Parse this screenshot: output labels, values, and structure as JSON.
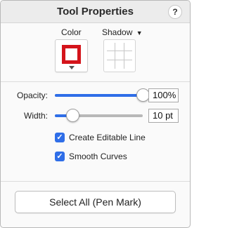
{
  "panel": {
    "title": "Tool Properties",
    "help_label": "?"
  },
  "appearance": {
    "color_label": "Color",
    "shadow_label": "Shadow",
    "shadow_caret": "▼",
    "stroke_color": "#d4141b",
    "accent_color": "#2f6ee8"
  },
  "opacity": {
    "label": "Opacity:",
    "value": "100%",
    "level": 1.0
  },
  "width": {
    "label": "Width:",
    "value": "10 pt",
    "level": 0.2
  },
  "options": {
    "create_editable_line": {
      "label": "Create Editable Line",
      "checked": true
    },
    "smooth_curves": {
      "label": "Smooth Curves",
      "checked": true
    }
  },
  "footer": {
    "select_all_label": "Select All (Pen Mark)"
  }
}
